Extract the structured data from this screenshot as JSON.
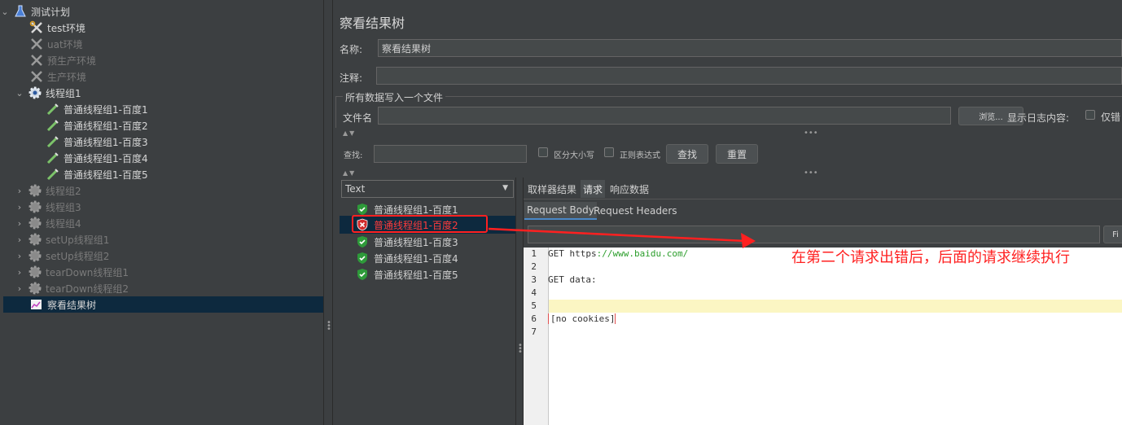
{
  "tree": {
    "items": [
      {
        "label": "测试计划",
        "icon": "flask-icon",
        "expanded": true,
        "enabled": true
      },
      {
        "label": "test环境",
        "icon": "wrench-scissors-icon",
        "enabled": true
      },
      {
        "label": "uat环境",
        "icon": "wrench-scissors-icon",
        "enabled": false
      },
      {
        "label": "预生产环境",
        "icon": "wrench-scissors-icon",
        "enabled": false
      },
      {
        "label": "生产环境",
        "icon": "wrench-scissors-icon",
        "enabled": false
      },
      {
        "label": "线程组1",
        "icon": "gear-icon",
        "expanded": true,
        "enabled": true
      },
      {
        "label": "普通线程组1-百度1",
        "icon": "pipette-icon",
        "enabled": true
      },
      {
        "label": "普通线程组1-百度2",
        "icon": "pipette-icon",
        "enabled": true
      },
      {
        "label": "普通线程组1-百度3",
        "icon": "pipette-icon",
        "enabled": true
      },
      {
        "label": "普通线程组1-百度4",
        "icon": "pipette-icon",
        "enabled": true
      },
      {
        "label": "普通线程组1-百度5",
        "icon": "pipette-icon",
        "enabled": true
      },
      {
        "label": "线程组2",
        "icon": "gear-icon",
        "enabled": false
      },
      {
        "label": "线程组3",
        "icon": "gear-icon",
        "enabled": false
      },
      {
        "label": "线程组4",
        "icon": "gear-icon",
        "enabled": false
      },
      {
        "label": "setUp线程组1",
        "icon": "gear-icon",
        "enabled": false
      },
      {
        "label": "setUp线程组2",
        "icon": "gear-icon",
        "enabled": false
      },
      {
        "label": "tearDown线程组1",
        "icon": "gear-icon",
        "enabled": false
      },
      {
        "label": "tearDown线程组2",
        "icon": "gear-icon",
        "enabled": false
      },
      {
        "label": "察看结果树",
        "icon": "graph-icon",
        "enabled": true,
        "selected": true
      }
    ]
  },
  "panel": {
    "title": "察看结果树",
    "name_label": "名称:",
    "name_value": "察看结果树",
    "comment_label": "注释:",
    "comment_value": "",
    "file_group_title": "所有数据写入一个文件",
    "file_label": "文件名",
    "file_value": "",
    "browse_label": "浏览...",
    "log_label": "显示日志内容:",
    "errors_only_label": "仅错"
  },
  "search": {
    "label": "查找:",
    "value": "",
    "case_label": "区分大小写",
    "regex_label": "正则表达式",
    "find_label": "查找",
    "reset_label": "重置"
  },
  "renderer": {
    "selected": "Text"
  },
  "results": [
    {
      "label": "普通线程组1-百度1",
      "status": "success"
    },
    {
      "label": "普通线程组1-百度2",
      "status": "error",
      "selected": true
    },
    {
      "label": "普通线程组1-百度3",
      "status": "success"
    },
    {
      "label": "普通线程组1-百度4",
      "status": "success"
    },
    {
      "label": "普通线程组1-百度5",
      "status": "success"
    }
  ],
  "tabs": {
    "main": [
      "取样器结果",
      "请求",
      "响应数据"
    ],
    "main_active": 1,
    "sub": [
      "Request Body",
      "Request Headers"
    ],
    "sub_active": 0,
    "find_button": "Fi"
  },
  "editor": {
    "lines": [
      {
        "num": "1",
        "text": "GET https://www.baidu.com/"
      },
      {
        "num": "2",
        "text": ""
      },
      {
        "num": "3",
        "text": "GET data:"
      },
      {
        "num": "4",
        "text": ""
      },
      {
        "num": "5",
        "text": ""
      },
      {
        "num": "6",
        "text": "[no cookies]"
      },
      {
        "num": "7",
        "text": ""
      }
    ],
    "highlighted_line": 5
  },
  "annotation": {
    "text": "在第二个请求出错后，后面的请求继续执行",
    "color": "#ff2020"
  },
  "colors": {
    "background": "#3c3f41",
    "selection": "#0d293e",
    "error_text": "#ff3b3b",
    "success_icon": "#3cb043",
    "editor_highlight": "#fbf6c3"
  }
}
